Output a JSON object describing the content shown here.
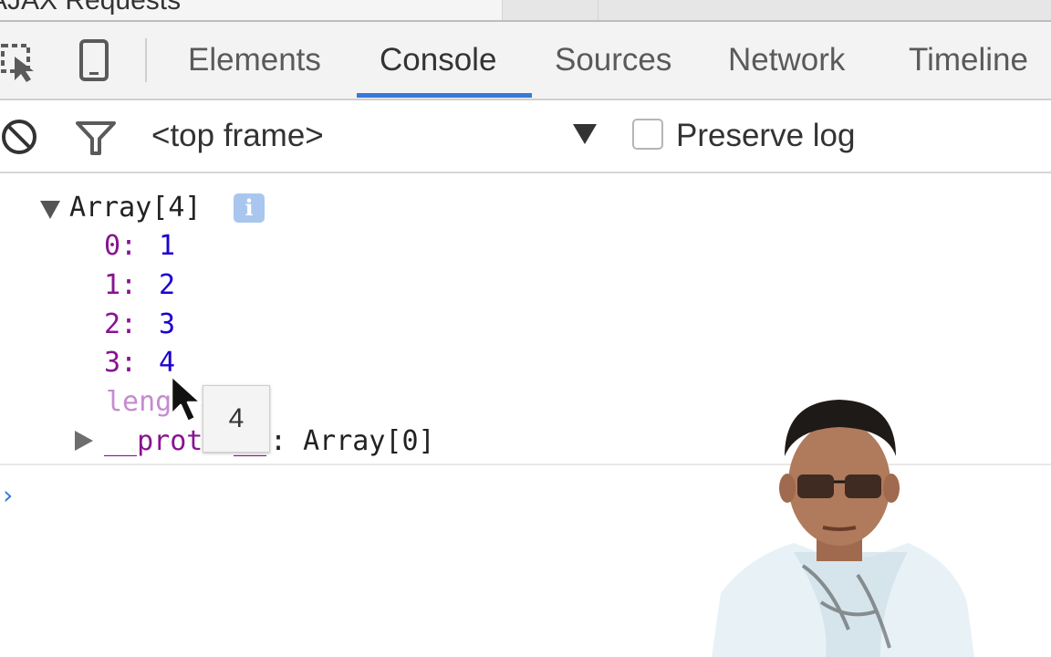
{
  "browser": {
    "tab_title": "AJAX Requests"
  },
  "devtools": {
    "toolbar": {
      "inspect_icon": "inspect-element-icon",
      "device_icon": "device-mode-icon",
      "tabs": [
        {
          "label": "Elements"
        },
        {
          "label": "Console",
          "active": true
        },
        {
          "label": "Sources"
        },
        {
          "label": "Network"
        },
        {
          "label": "Timeline"
        }
      ]
    },
    "console_toolbar": {
      "clear_icon": "clear-console-icon",
      "filter_icon": "filter-icon",
      "context": "<top frame>",
      "preserve_log_label": "Preserve log",
      "preserve_log_checked": false
    },
    "console": {
      "array_label": "Array[4]",
      "info_badge": "i",
      "entries": [
        {
          "key": "0",
          "value": "1"
        },
        {
          "key": "1",
          "value": "2"
        },
        {
          "key": "2",
          "value": "3"
        },
        {
          "key": "3",
          "value": "4"
        }
      ],
      "length_key_visible": "leng",
      "proto_key_visible": "__prot",
      "proto_key_tail": "__",
      "proto_value": ": Array[0]",
      "tooltip": "4",
      "prompt": "›"
    }
  },
  "colors": {
    "accent": "#3879d9",
    "key": "#881391",
    "number": "#1c00cf"
  }
}
